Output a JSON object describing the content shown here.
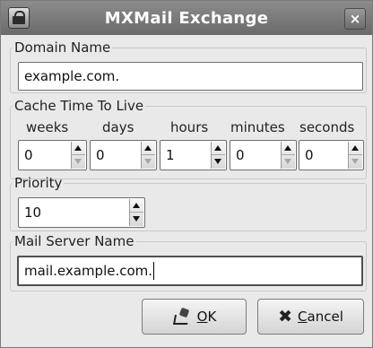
{
  "window": {
    "title": "MXMail Exchange",
    "close_label": "×"
  },
  "domain": {
    "legend": "Domain Name",
    "value": "example.com."
  },
  "cache": {
    "legend": "Cache Time To Live",
    "columns": [
      {
        "label": "weeks",
        "value": "0"
      },
      {
        "label": "days",
        "value": "0"
      },
      {
        "label": "hours",
        "value": "1"
      },
      {
        "label": "minutes",
        "value": "0"
      },
      {
        "label": "seconds",
        "value": "0"
      }
    ]
  },
  "priority": {
    "legend": "Priority",
    "value": "10"
  },
  "mailserver": {
    "legend": "Mail Server Name",
    "value": "mail.example.com."
  },
  "buttons": {
    "ok": "OK",
    "cancel": "Cancel"
  },
  "icons": {
    "app": "mail-app-icon",
    "close": "close-icon",
    "ok": "ok-icon",
    "cancel": "cancel-icon"
  }
}
